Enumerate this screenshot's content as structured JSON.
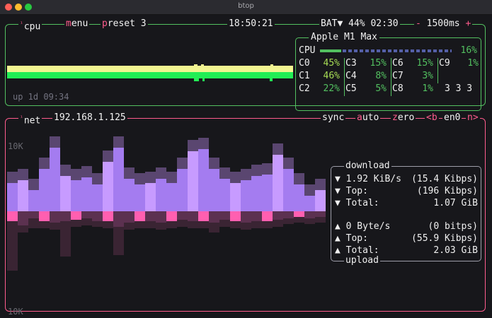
{
  "window": {
    "title": "btop"
  },
  "cpu_box": {
    "tab_cpu": "cpu",
    "tab_cpu_num": "¹",
    "menu_hot": "m",
    "menu_rest": "enu",
    "preset_hot": "p",
    "preset_rest": "reset 3",
    "clock": "18:50:21",
    "battery": "BAT▼ 44% 02:30",
    "interval_minus": "-",
    "interval": "1500ms",
    "interval_plus": "+",
    "uptime": "up 1d 09:34",
    "cpu_model": "Apple M1 Max",
    "cpu_label": "CPU",
    "cpu_pct": "16%",
    "cpu_fraction": 0.16,
    "cores": [
      {
        "name": "C0",
        "value": "45%"
      },
      {
        "name": "C1",
        "value": "46%"
      },
      {
        "name": "C2",
        "value": "22%"
      },
      {
        "name": "C3",
        "value": "15%"
      },
      {
        "name": "C4",
        "value": "8%"
      },
      {
        "name": "C5",
        "value": "5%"
      },
      {
        "name": "C6",
        "value": "15%"
      },
      {
        "name": "C7",
        "value": "3%"
      },
      {
        "name": "C8",
        "value": "1%"
      },
      {
        "name": "C9",
        "value": "1%"
      }
    ],
    "load": "3 3 3"
  },
  "net_box": {
    "tab_num": "¹",
    "tab_net": "net",
    "ip": "192.168.1.125",
    "sync": "sync",
    "auto_hot": "a",
    "auto_rest": "uto",
    "zero_hot": "z",
    "zero_rest": "ero",
    "prev_iface": "<b",
    "iface": "en0",
    "next_iface": "n>",
    "scale_top": "10K",
    "scale_bottom": "10K",
    "download": {
      "title": "download",
      "rate": "▼ 1.92 KiB/s",
      "rate_bits": "(15.4 Kibps)",
      "top_label": "▼ Top:",
      "top_value": "(196 Kibps)",
      "total_label": "▼ Total:",
      "total_value": "1.07 GiB"
    },
    "upload": {
      "title": "upload",
      "rate": "▲ 0 Byte/s",
      "rate_bits": "(0 bitps)",
      "top_label": "▲ Top:",
      "top_value": "(55.9 Kibps)",
      "total_label": "▲ Total:",
      "total_value": "2.03 GiB"
    }
  },
  "colors": {
    "cpu_border": "#53c060",
    "net_border": "#ff5c8d",
    "hotkey": "#ff5c8d",
    "download_graph": "#b388ff",
    "upload_graph": "#ff5fb0"
  }
}
